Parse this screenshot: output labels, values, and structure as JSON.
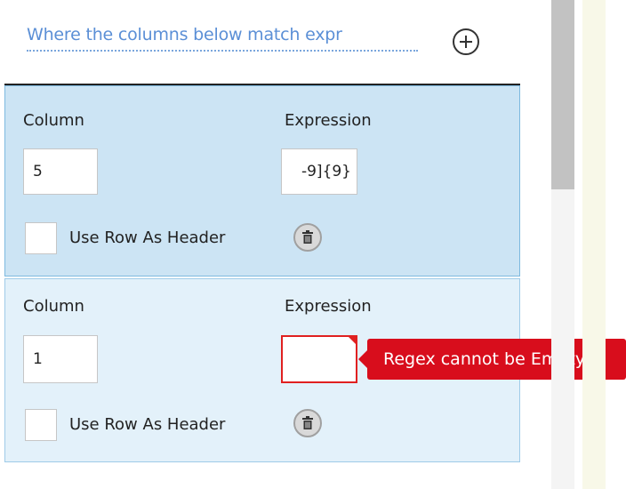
{
  "header": {
    "match_link": "Where the columns below match expr"
  },
  "rows": [
    {
      "column_label": "Column",
      "expression_label": "Expression",
      "column_value": "5",
      "expression_value": "-9]{9}",
      "header_checkbox_label": "Use Row As Header"
    },
    {
      "column_label": "Column",
      "expression_label": "Expression",
      "column_value": "1",
      "expression_value": "",
      "header_checkbox_label": "Use Row As Header"
    }
  ],
  "validation": {
    "error_message": "Regex cannot be Empty"
  },
  "colors": {
    "selected_row": "#cce4f4",
    "row": "#e3f1fa",
    "error": "#d80d1c",
    "link": "#5b8fd6"
  },
  "icons": {
    "add": "plus-circle-icon",
    "delete": "trash-icon"
  }
}
